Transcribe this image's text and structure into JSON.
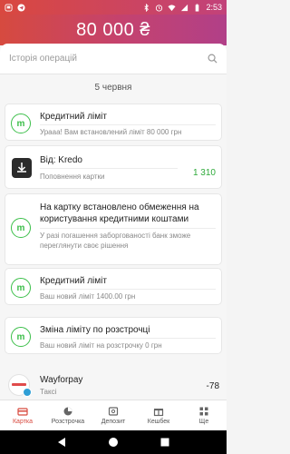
{
  "status_bar": {
    "time": "2:53",
    "left_icons": [
      "flag-icon",
      "telegram-icon"
    ],
    "right_icons": [
      "bluetooth-icon",
      "alarm-icon",
      "wifi-icon",
      "signal-icon",
      "battery-icon"
    ]
  },
  "header": {
    "balance": "80 000 ₴"
  },
  "search": {
    "placeholder": "Історія операцій",
    "icon": "search-icon"
  },
  "date_label": "5 червня",
  "transactions": [
    {
      "icon": "monobank-m-icon",
      "title": "Кредитний ліміт",
      "subtitle": "Урааа! Вам встановлений ліміт 80 000 грн",
      "amount": ""
    },
    {
      "icon": "kredo-download-icon",
      "title": "Від: Kredo",
      "subtitle": "Поповнення картки",
      "amount": "1 310"
    },
    {
      "icon": "monobank-m-icon",
      "title": "На картку встановлено обмеження на користування кредитними коштами",
      "subtitle": "У разі погашення заборгованості банк зможе переглянути своє рішення",
      "amount": ""
    },
    {
      "icon": "monobank-m-icon",
      "title": "Кредитний ліміт",
      "subtitle": "Ваш новий ліміт 1400.00 грн",
      "amount": ""
    },
    {
      "icon": "monobank-m-icon",
      "title": "Зміна ліміту по розстрочці",
      "subtitle": "Ваш новий ліміт на розстрочку 0 грн",
      "amount": ""
    },
    {
      "icon": "wayforpay-logo-icon",
      "title": "Wayforpay",
      "subtitle": "Таксі",
      "amount": "-78"
    }
  ],
  "tabs": [
    {
      "label": "Картка",
      "icon": "card-icon",
      "active": true
    },
    {
      "label": "Розстрочка",
      "icon": "pie-chart-icon",
      "active": false
    },
    {
      "label": "Депозит",
      "icon": "safe-icon",
      "active": false
    },
    {
      "label": "Кешбек",
      "icon": "gift-icon",
      "active": false
    },
    {
      "label": "Ще",
      "icon": "grid-icon",
      "active": false
    }
  ],
  "colors": {
    "accent": "#d84a3f",
    "positive": "#2eaa3a",
    "mono_green": "#3cbf4a"
  }
}
